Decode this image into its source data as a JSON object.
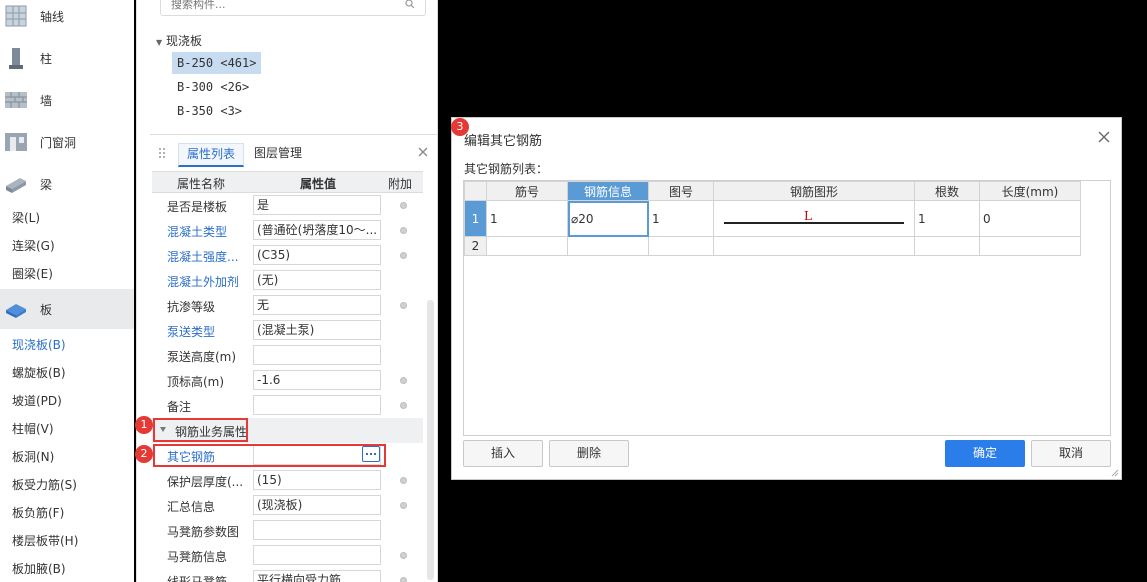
{
  "nav": {
    "categories": [
      {
        "label": "轴线",
        "icon": "axis-grid-icon"
      },
      {
        "label": "柱",
        "icon": "column-icon"
      },
      {
        "label": "墙",
        "icon": "wall-icon"
      },
      {
        "label": "门窗洞",
        "icon": "door-window-icon"
      },
      {
        "label": "梁",
        "icon": "beam-icon"
      }
    ],
    "beam_items": [
      "梁(L)",
      "连梁(G)",
      "圈梁(E)"
    ],
    "slab_category": {
      "label": "板",
      "icon": "slab-icon"
    },
    "slab_items": [
      "现浇板(B)",
      "螺旋板(B)",
      "坡道(PD)",
      "柱帽(V)",
      "板洞(N)",
      "板受力筋(S)",
      "板负筋(F)",
      "楼层板带(H)",
      "板加腋(B)"
    ],
    "selected_item": "现浇板(B)"
  },
  "tree": {
    "search_placeholder": "搜索构件...",
    "root": "现浇板",
    "items": [
      "B-250 <461>",
      "B-300 <26>",
      "B-350 <3>"
    ],
    "selected": "B-250 <461>"
  },
  "props": {
    "tabs": [
      "属性列表",
      "图层管理"
    ],
    "columns": [
      "属性名称",
      "属性值",
      "附加"
    ],
    "rows": [
      {
        "name": "是否是楼板",
        "value": "是"
      },
      {
        "name": "混凝土类型",
        "value": "(普通砼(坍落度10～..."
      },
      {
        "name": "混凝土强度...",
        "value": "(C35)"
      },
      {
        "name": "混凝土外加剂",
        "value": "(无)"
      },
      {
        "name": "抗渗等级",
        "value": "无"
      },
      {
        "name": "泵送类型",
        "value": "(混凝土泵)"
      },
      {
        "name": "泵送高度(m)",
        "value": ""
      },
      {
        "name": "顶标高(m)",
        "value": "-1.6"
      },
      {
        "name": "备注",
        "value": ""
      },
      {
        "name": "钢筋业务属性",
        "value": ""
      },
      {
        "name": "其它钢筋",
        "value": ""
      },
      {
        "name": "保护层厚度(...",
        "value": "(15)"
      },
      {
        "name": "汇总信息",
        "value": "(现浇板)"
      },
      {
        "name": "马凳筋参数图",
        "value": ""
      },
      {
        "name": "马凳筋信息",
        "value": ""
      },
      {
        "name": "线形马凳筋...",
        "value": "平行横向受力筋"
      }
    ],
    "badges": [
      "1",
      "2"
    ]
  },
  "dialog": {
    "badge": "3",
    "title": "编辑其它钢筋",
    "subtitle": "其它钢筋列表：",
    "columns": [
      "筋号",
      "钢筋信息",
      "图号",
      "钢筋图形",
      "根数",
      "长度(mm)"
    ],
    "rows": [
      {
        "index": "1",
        "bar_no": "1",
        "info": "⌀20",
        "fig_no": "1",
        "shape_label": "L",
        "count": "1",
        "length": "0"
      },
      {
        "index": "2",
        "bar_no": "",
        "info": "",
        "fig_no": "",
        "shape_label": "",
        "count": "",
        "length": ""
      }
    ],
    "buttons": {
      "insert": "插入",
      "delete": "删除",
      "ok": "确定",
      "cancel": "取消"
    }
  },
  "colors": {
    "accent": "#2b7de9",
    "link": "#2b6fc8",
    "marker": "#e53935",
    "grid_highlight": "#5b9bd5"
  }
}
